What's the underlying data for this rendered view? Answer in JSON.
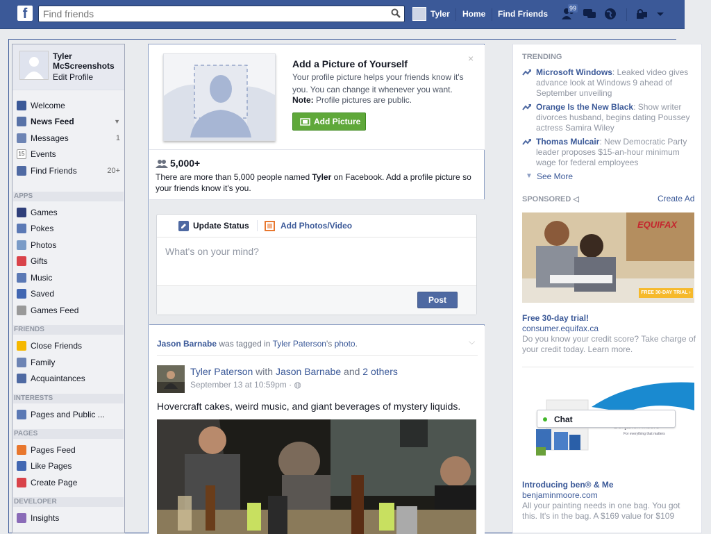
{
  "topbar": {
    "search_placeholder": "Find friends",
    "user_name": "Tyler",
    "home_label": "Home",
    "find_friends_label": "Find Friends",
    "friend_requests_count": "99"
  },
  "leftnav": {
    "profile_name": "Tyler McScreenshots",
    "edit_profile": "Edit Profile",
    "favorites": [
      {
        "label": "Welcome",
        "icon": "facebook-icon",
        "count": ""
      },
      {
        "label": "News Feed",
        "icon": "news-feed-icon",
        "count": ""
      },
      {
        "label": "Messages",
        "icon": "messages-icon",
        "count": "1"
      },
      {
        "label": "Events",
        "icon": "events-icon",
        "count": ""
      },
      {
        "label": "Find Friends",
        "icon": "find-friends-icon",
        "count": "20+"
      }
    ],
    "events_icon_text": "15",
    "apps_header": "APPS",
    "apps": [
      {
        "label": "Games",
        "icon": "games-icon"
      },
      {
        "label": "Pokes",
        "icon": "pokes-icon"
      },
      {
        "label": "Photos",
        "icon": "photos-icon"
      },
      {
        "label": "Gifts",
        "icon": "gifts-icon"
      },
      {
        "label": "Music",
        "icon": "music-icon"
      },
      {
        "label": "Saved",
        "icon": "saved-icon"
      },
      {
        "label": "Games Feed",
        "icon": "games-feed-icon"
      }
    ],
    "friends_header": "FRIENDS",
    "friends": [
      {
        "label": "Close Friends",
        "icon": "close-friends-icon"
      },
      {
        "label": "Family",
        "icon": "family-icon"
      },
      {
        "label": "Acquaintances",
        "icon": "acquaintances-icon"
      }
    ],
    "interests_header": "INTERESTS",
    "interests": [
      {
        "label": "Pages and Public ...",
        "icon": "pages-public-icon"
      }
    ],
    "pages_header": "PAGES",
    "pages": [
      {
        "label": "Pages Feed",
        "icon": "pages-feed-icon"
      },
      {
        "label": "Like Pages",
        "icon": "like-pages-icon"
      },
      {
        "label": "Create Page",
        "icon": "create-page-icon"
      }
    ],
    "developer_header": "DEVELOPER",
    "developer": [
      {
        "label": "Insights",
        "icon": "insights-icon"
      }
    ]
  },
  "picture_card": {
    "title": "Add a Picture of Yourself",
    "description": "Your profile picture helps your friends know it's you. You can change it whenever you want.",
    "note_label": "Note:",
    "note_text": " Profile pictures are public.",
    "button": "Add Picture",
    "close": "×"
  },
  "name_card": {
    "count": "5,000+",
    "text_before": "There are more than 5,000 people named ",
    "name": "Tyler",
    "text_after": " on Facebook. Add a profile picture so your friends know it's you."
  },
  "composer": {
    "tab_status": "Update Status",
    "tab_photos": "Add Photos/Video",
    "placeholder": "What's on your mind?",
    "post": "Post"
  },
  "story": {
    "tagged_user": "Jason Barnabe",
    "tagged_text": " was tagged in ",
    "owner": "Tyler Paterson",
    "possessive": "'s ",
    "photo_link": "photo",
    "period": ".",
    "author": "Tyler Paterson",
    "with_text": " with ",
    "with_user": "Jason Barnabe",
    "and_text": " and ",
    "others": "2 others",
    "time": "September 13 at 10:59pm · ",
    "text": "Hovercraft cakes, weird music, and giant beverages of mystery liquids."
  },
  "rightcol": {
    "trending_header": "TRENDING",
    "trending": [
      {
        "title": "Microsoft Windows",
        "text": ": Leaked video gives advance look at Windows 9 ahead of September unveiling"
      },
      {
        "title": "Orange Is the New Black",
        "text": ": Show writer divorces husband, begins dating Poussey actress Samira Wiley"
      },
      {
        "title": "Thomas Mulcair",
        "text": ": New Democratic Party leader proposes $15-an-hour minimum wage for federal employees"
      }
    ],
    "see_more": "See More",
    "sponsored_header": "SPONSORED",
    "create_ad": "Create Ad",
    "ad1": {
      "brand": "EQUIFAX",
      "banner": "FREE 30-DAY TRIAL ›",
      "title": "Free 30-day trial!",
      "url": "consumer.equifax.ca",
      "description": "Do you know your credit score? Take charge of your credit today. Learn more."
    },
    "ad2": {
      "brand": "Benjamin Moore",
      "tagline": "For everything that matters",
      "title": "Introducing ben® & Me",
      "url": "benjaminmoore.com",
      "description": "All your painting needs in one bag. You got this. It's in the bag. A $169 value for $109"
    }
  },
  "chat": {
    "label": "Chat"
  },
  "colors": {
    "brand": "#3b5998",
    "green_button": "#5fa83a",
    "link": "#3b5998"
  }
}
